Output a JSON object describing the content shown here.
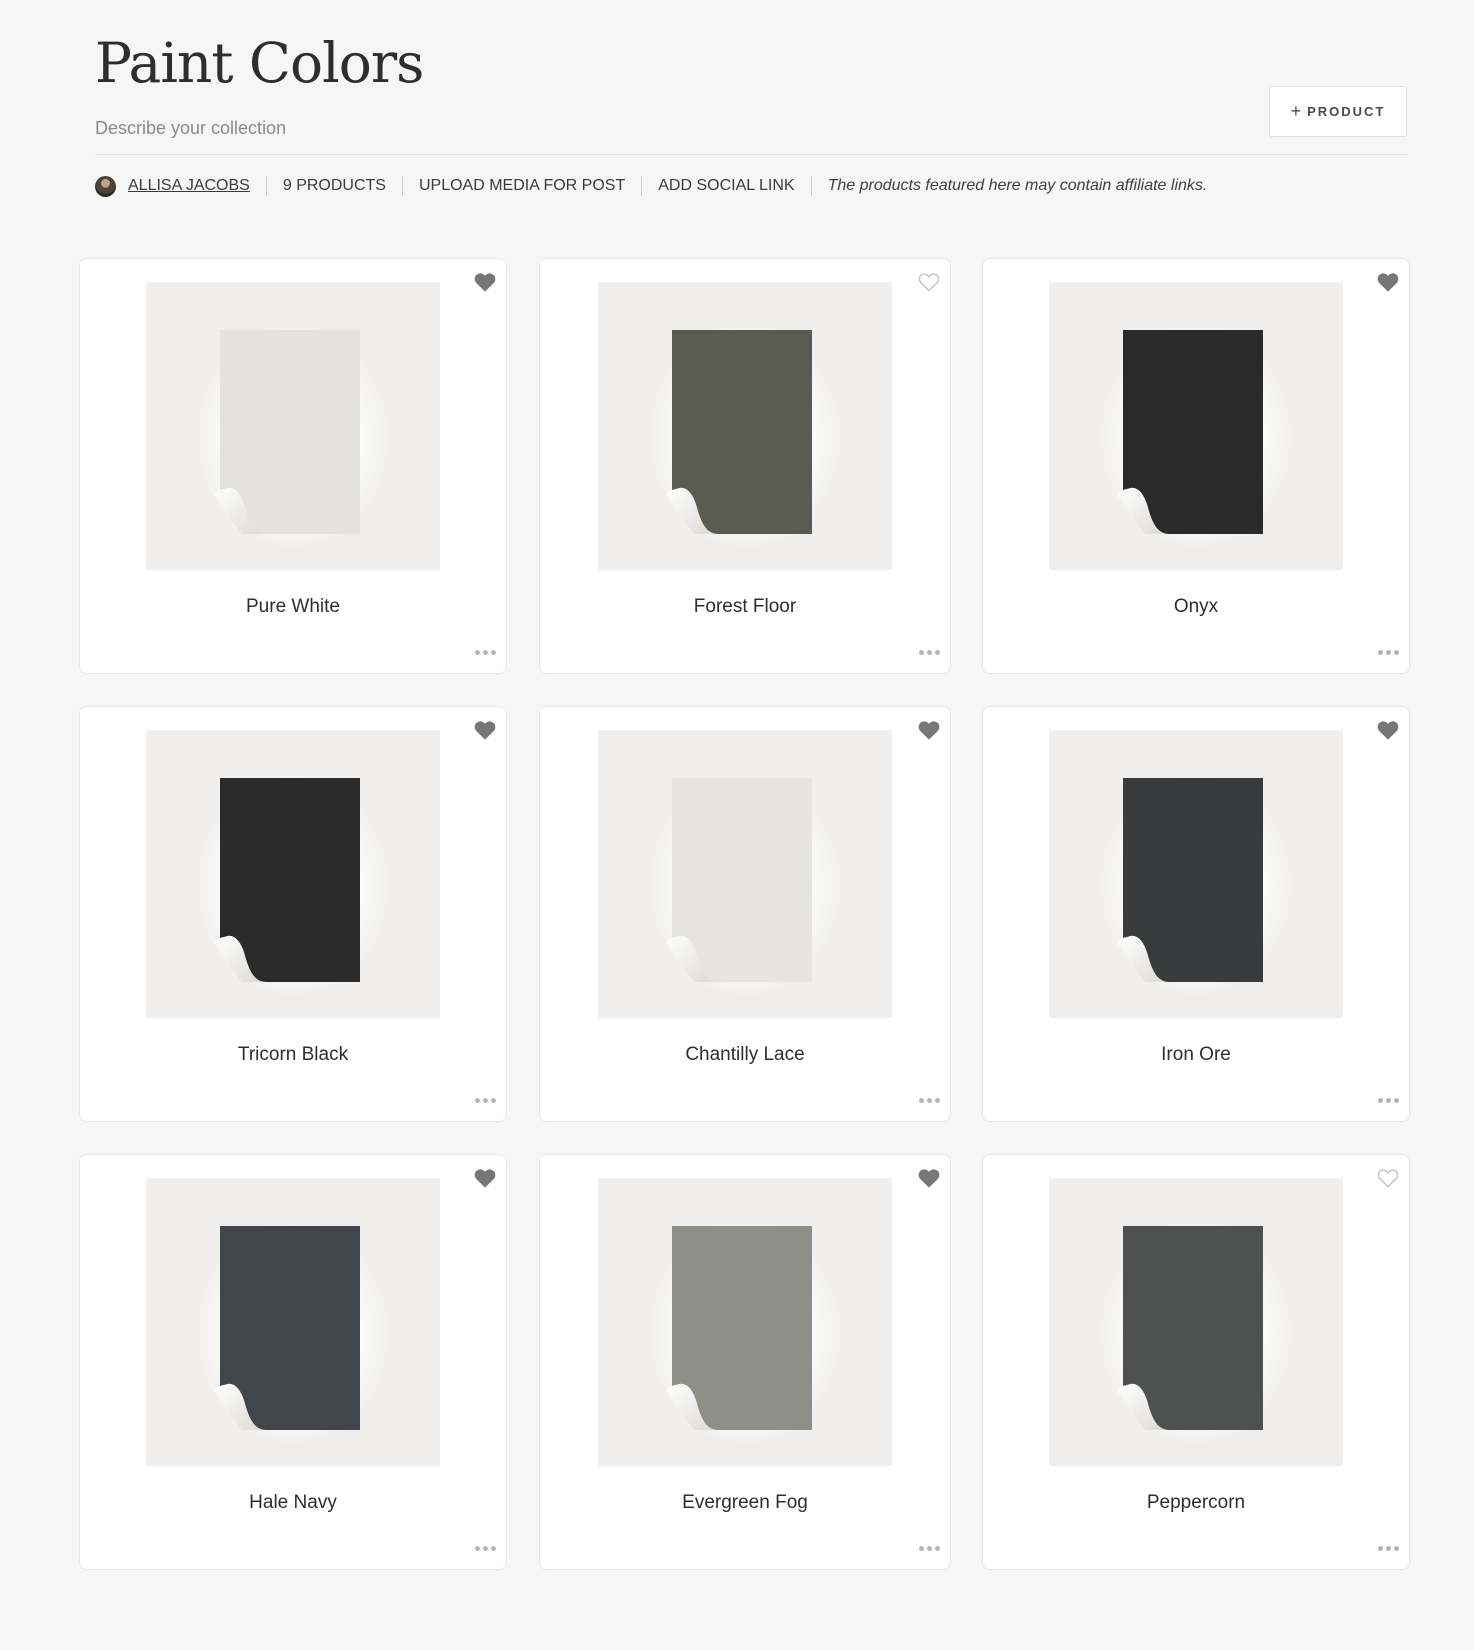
{
  "header": {
    "title": "Paint Colors",
    "subtitle": "Describe your collection",
    "add_button": {
      "icon": "plus-icon",
      "label": "PRODUCT"
    }
  },
  "meta": {
    "author": "ALLISA JACOBS",
    "product_count": "9 PRODUCTS",
    "upload_media": "UPLOAD MEDIA FOR POST",
    "add_social": "ADD SOCIAL LINK",
    "affiliate_note": "The products featured here may contain affiliate links."
  },
  "products": [
    {
      "name": "Pure White",
      "swatch": "#e3e2df",
      "favorited": true
    },
    {
      "name": "Forest Floor",
      "swatch": "#5a5b51",
      "favorited": false
    },
    {
      "name": "Onyx",
      "swatch": "#2a2a2a",
      "favorited": true
    },
    {
      "name": "Tricorn Black",
      "swatch": "#2b2b2b",
      "favorited": true
    },
    {
      "name": "Chantilly Lace",
      "swatch": "#e6e5e2",
      "favorited": true
    },
    {
      "name": "Iron Ore",
      "swatch": "#393b3d",
      "favorited": true
    },
    {
      "name": "Hale Navy",
      "swatch": "#41464d",
      "favorited": true
    },
    {
      "name": "Evergreen Fog",
      "swatch": "#8e8f86",
      "favorited": true
    },
    {
      "name": "Peppercorn",
      "swatch": "#4f5150",
      "favorited": false
    }
  ],
  "colors": {
    "heart_filled": "#777777",
    "heart_outline": "#c4c4c4",
    "background": "#f6f6f6"
  }
}
